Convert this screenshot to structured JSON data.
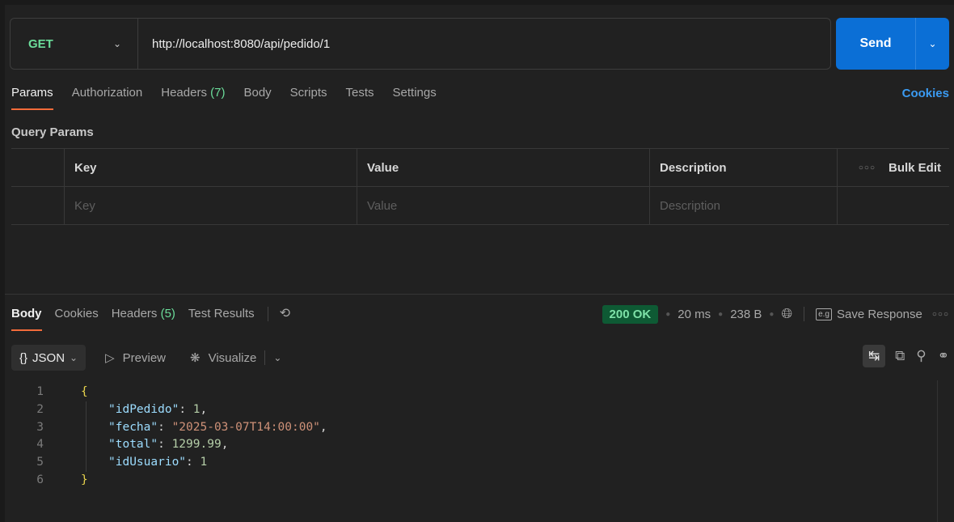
{
  "request": {
    "method": "GET",
    "url": "http://localhost:8080/api/pedido/1",
    "send_label": "Send"
  },
  "req_tabs": {
    "params": "Params",
    "authorization": "Authorization",
    "headers": "Headers",
    "headers_count": "(7)",
    "body": "Body",
    "scripts": "Scripts",
    "tests": "Tests",
    "settings": "Settings",
    "cookies": "Cookies"
  },
  "query_params": {
    "title": "Query Params",
    "headers": {
      "key": "Key",
      "value": "Value",
      "description": "Description",
      "bulk_edit": "Bulk Edit"
    },
    "placeholders": {
      "key": "Key",
      "value": "Value",
      "description": "Description"
    }
  },
  "response": {
    "tabs": {
      "body": "Body",
      "cookies": "Cookies",
      "headers": "Headers",
      "headers_count": "(5)",
      "test_results": "Test Results"
    },
    "status": "200 OK",
    "time": "20 ms",
    "size": "238 B",
    "save_response": "Save Response",
    "format": "JSON",
    "preview": "Preview",
    "visualize": "Visualize"
  },
  "code": {
    "line_numbers": [
      "1",
      "2",
      "3",
      "4",
      "5",
      "6"
    ],
    "open_brace": "{",
    "close_brace": "}",
    "fields": [
      {
        "key": "\"idPedido\"",
        "value": "1",
        "suffix": ","
      },
      {
        "key": "\"fecha\"",
        "value": "\"2025-03-07T14:00:00\"",
        "suffix": ","
      },
      {
        "key": "\"total\"",
        "value": "1299.99",
        "suffix": ","
      },
      {
        "key": "\"idUsuario\"",
        "value": "1",
        "suffix": ""
      }
    ]
  },
  "colors": {
    "accent": "#0b6fd6",
    "method_green": "#6bdd9a",
    "tab_underline": "#f26b3a",
    "status_bg": "#0e5a34"
  }
}
